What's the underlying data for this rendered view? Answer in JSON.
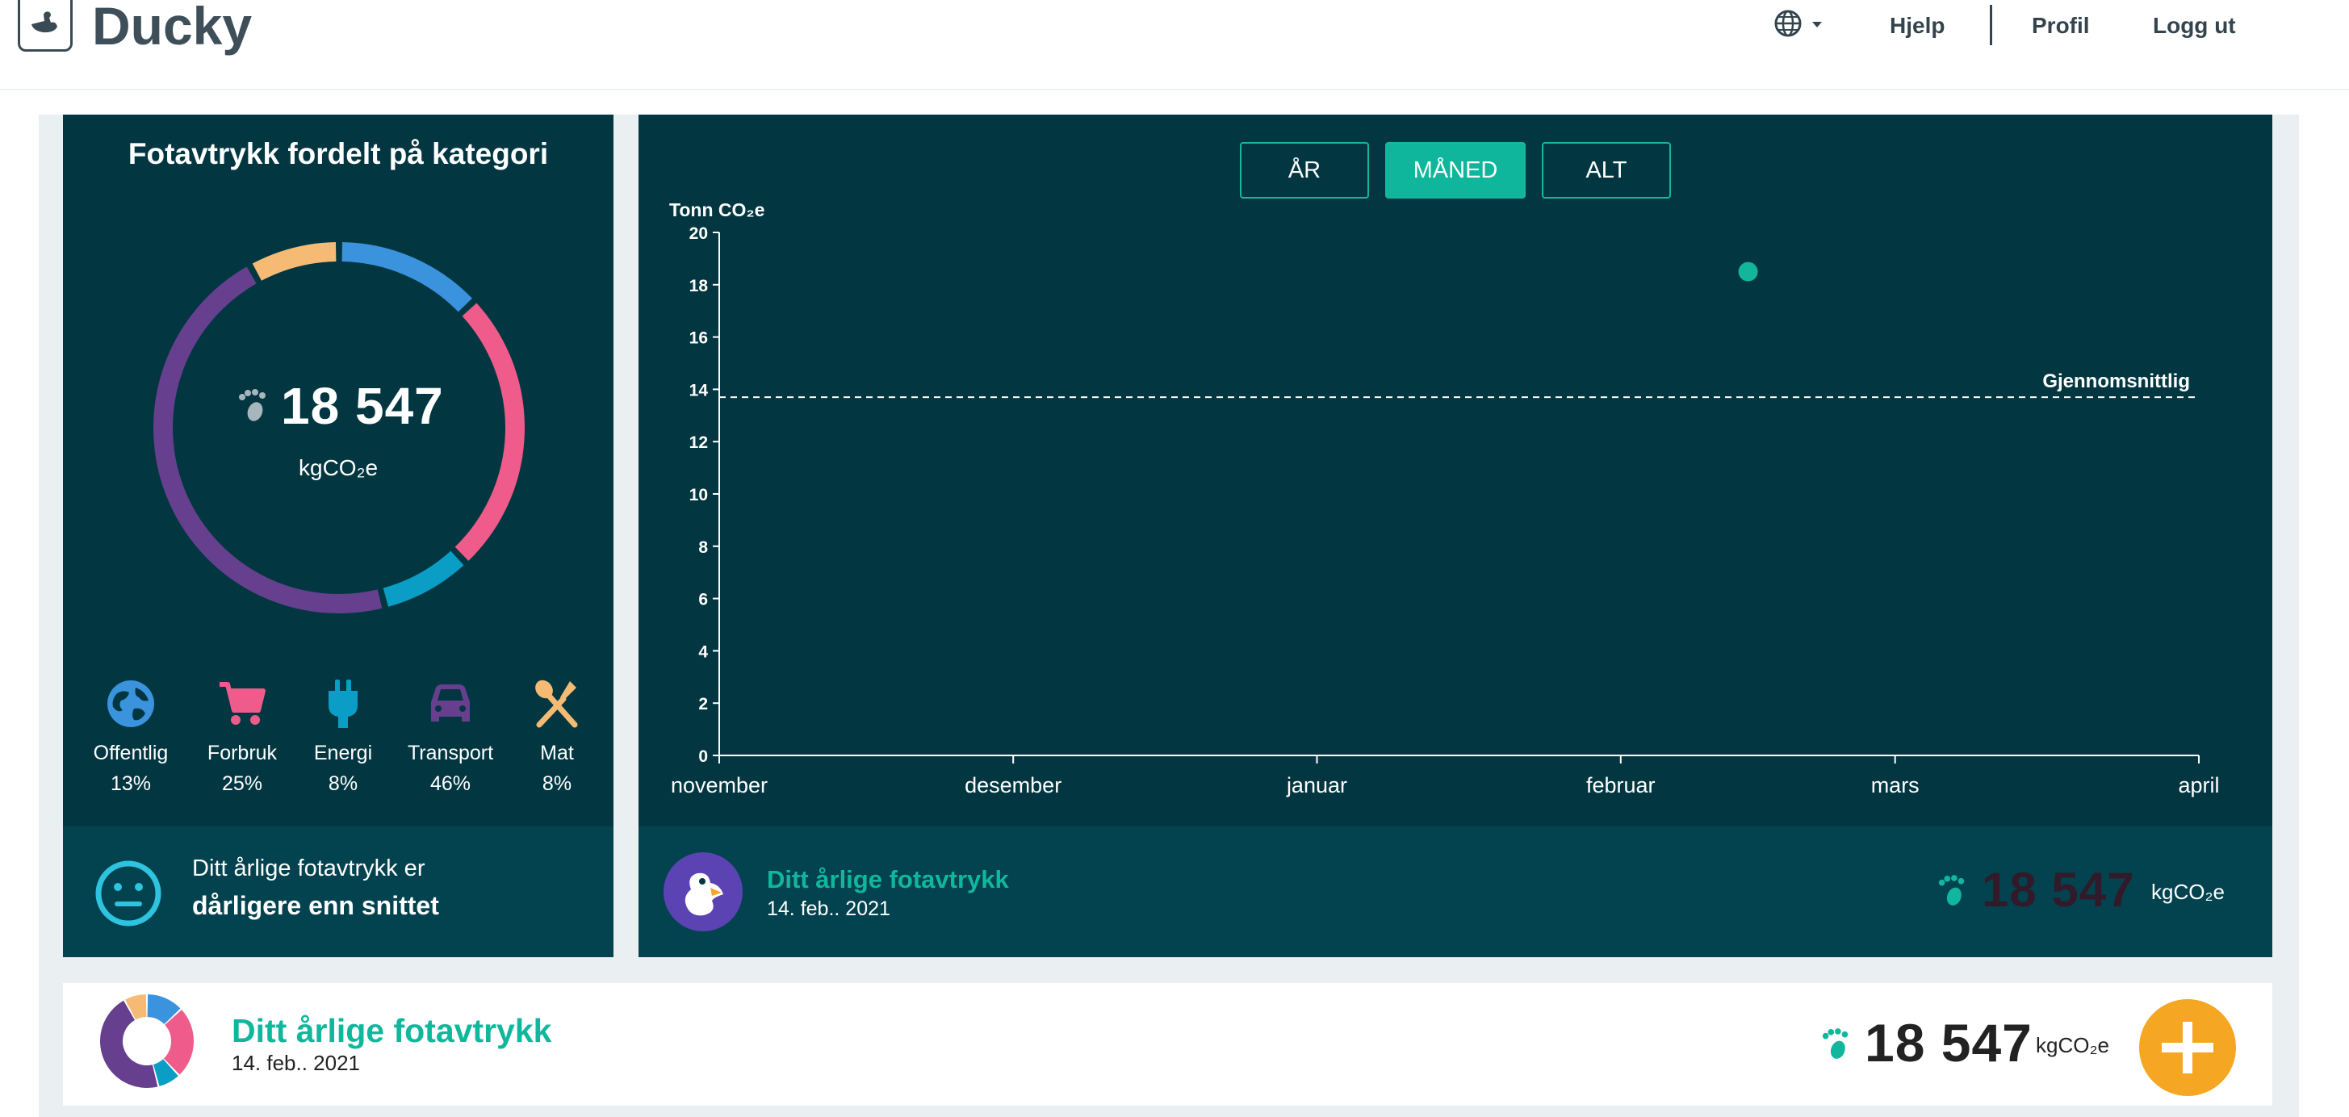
{
  "header": {
    "logo_text": "Ducky",
    "nav": {
      "help": "Hjelp",
      "profile": "Profil",
      "logout": "Logg ut"
    },
    "icons": {
      "language": "globe-icon",
      "language_caret": "caret-down-icon"
    }
  },
  "category_panel": {
    "title": "Fotavtrykk fordelt på kategori",
    "total": "18 547",
    "unit": "kgCO₂e",
    "categories": [
      {
        "label": "Offentlig",
        "percent": "13%",
        "value": 13,
        "color": "#3b93dd",
        "icon": "globe-icon"
      },
      {
        "label": "Forbruk",
        "percent": "25%",
        "value": 25,
        "color": "#ef5b8a",
        "icon": "shopping-cart-icon"
      },
      {
        "label": "Energi",
        "percent": "8%",
        "value": 8,
        "color": "#0a9ec6",
        "icon": "plug-icon"
      },
      {
        "label": "Transport",
        "percent": "46%",
        "value": 46,
        "color": "#673f8f",
        "icon": "car-icon"
      },
      {
        "label": "Mat",
        "percent": "8%",
        "value": 8,
        "color": "#f5bb74",
        "icon": "utensils-icon"
      }
    ],
    "footer_line1": "Ditt årlige fotavtrykk er",
    "footer_line2": "dårligere enn snittet"
  },
  "period_buttons": {
    "year": "ÅR",
    "month": "MÅNED",
    "all": "ALT",
    "active": "month"
  },
  "chart_data": {
    "type": "scatter",
    "ylabel": "Tonn CO₂e",
    "ylim": [
      0,
      20
    ],
    "yticks": [
      "20",
      "18",
      "16",
      "14",
      "12",
      "10",
      "8",
      "6",
      "4",
      "2",
      "0"
    ],
    "x_labels": [
      "november",
      "desember",
      "januar",
      "februar",
      "mars",
      "april"
    ],
    "points": [
      {
        "x": "2021-02-14",
        "y": 18.5
      }
    ],
    "reference_line": {
      "label": "Gjennomsnittlig",
      "y": 13.7
    },
    "colors": {
      "point": "#13b59b"
    }
  },
  "chart_footer": {
    "title": "Ditt årlige fotavtrykk",
    "date": "14. feb.. 2021",
    "value": "18 547",
    "unit": "kgCO₂e"
  },
  "bottom_card": {
    "title": "Ditt årlige fotavtrykk",
    "date": "14. feb.. 2021",
    "value": "18 547",
    "unit": "kgCO₂e"
  }
}
